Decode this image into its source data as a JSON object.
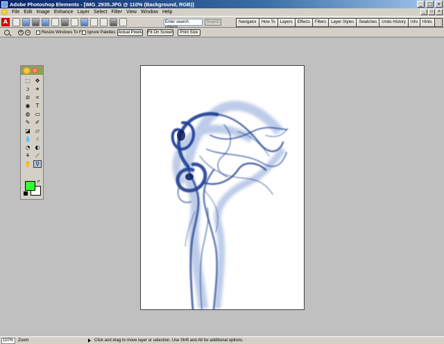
{
  "window": {
    "title": "Adobe Photoshop Elements - [IMG_2935.JPG @ 110% (Background, RGB)]",
    "controls": [
      "_",
      "□",
      "×"
    ]
  },
  "menubar": {
    "items": [
      "File",
      "Edit",
      "Image",
      "Enhance",
      "Layer",
      "Select",
      "Filter",
      "View",
      "Window",
      "Help"
    ],
    "mdi_controls": [
      "_",
      "□",
      "×"
    ]
  },
  "shortcuts": {
    "logo": "A",
    "search_placeholder": "Enter search criteria",
    "search_button": "Search"
  },
  "palette_well": {
    "tabs": [
      "Navigator",
      "How To",
      "Layers",
      "Effects",
      "Filters",
      "Layer Styles",
      "Swatches",
      "Undo History",
      "Info",
      "Hints"
    ]
  },
  "options": {
    "resize_windows_label": "Resize Windows To Fit",
    "ignore_palettes_label": "Ignore Palettes",
    "actual_pixels": "Actual Pixels",
    "fit_on_screen": "Fit On Screen",
    "print_size": "Print Size"
  },
  "toolbox": {
    "tools": [
      "marquee-icon",
      "move-icon",
      "lasso-icon",
      "magic-wand-icon",
      "brush-selection-icon",
      "crop-icon",
      "red-eye-icon",
      "type-icon",
      "paint-bucket-icon",
      "gradient-icon",
      "brush-icon",
      "pencil-icon",
      "eraser-icon",
      "shape-icon",
      "blur-icon",
      "smudge-icon",
      "sponge-icon",
      "dodge-icon",
      "clone-stamp-icon",
      "eyedropper-icon",
      "hand-icon",
      "zoom-icon"
    ],
    "glyphs": [
      "⬚",
      "✥",
      "ↄ",
      "✶",
      "⊘",
      "⌗",
      "◉",
      "T",
      "◍",
      "▭",
      "✎",
      "✐",
      "◪",
      "▱",
      "💧",
      "☝",
      "◔",
      "◐",
      "⚘",
      "⟋",
      "✋",
      "⚲"
    ],
    "foreground_color": "#33ff33",
    "background_color": "#ffffff"
  },
  "status": {
    "zoom": "110%",
    "zoom_label": "Zoom",
    "hint": "Click and drag to move layer or selection.  Use Shift and Alt for additional options."
  }
}
